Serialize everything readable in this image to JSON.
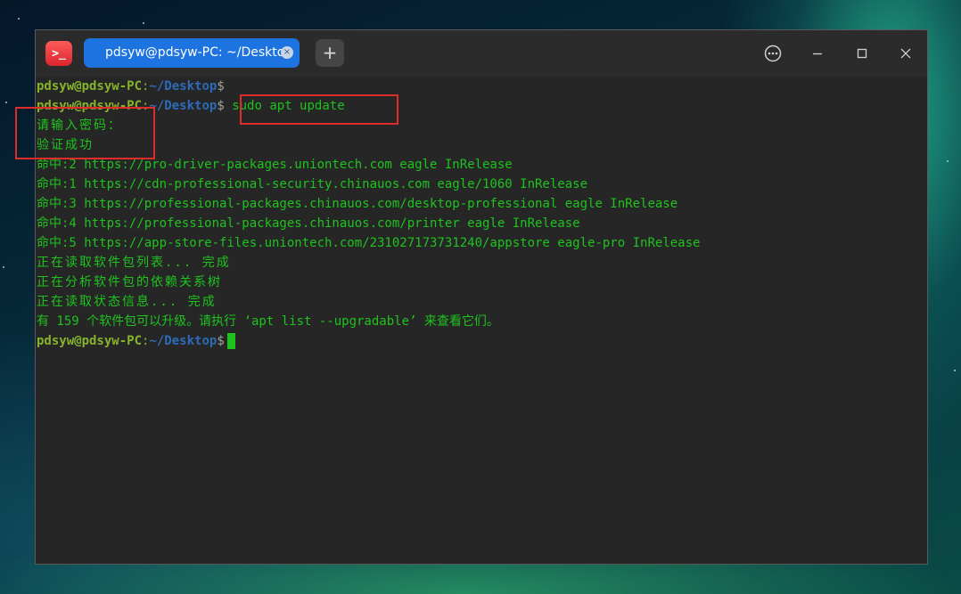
{
  "window": {
    "tab_title": "pdsyw@pdsyw-PC: ~/Desktop",
    "tab_close_glyph": "×",
    "add_tab_glyph": "+",
    "app_icon_glyph": ">_",
    "accent_color": "#1d74e0"
  },
  "terminal": {
    "prompt_user": "pdsyw@pdsyw-PC",
    "prompt_colon": ":",
    "prompt_path": "~/Desktop",
    "prompt_dollar": "$",
    "command": "sudo apt update",
    "password_prompt": "请输入密码：",
    "auth_success": "验证成功",
    "hits": [
      "命中:2 https://pro-driver-packages.uniontech.com eagle InRelease",
      "命中:1 https://cdn-professional-security.chinauos.com eagle/1060 InRelease",
      "命中:3 https://professional-packages.chinauos.com/desktop-professional eagle InRelease",
      "命中:4 https://professional-packages.chinauos.com/printer eagle InRelease",
      "命中:5 https://app-store-files.uniontech.com/231027173731240/appstore eagle-pro InRelease"
    ],
    "reading_lists": "正在读取软件包列表... 完成",
    "analyzing_deps": "正在分析软件包的依赖关系树",
    "reading_state": "正在读取状态信息... 完成",
    "upgradable_msg": "有 159 个软件包可以升级。请执行 ‘apt list --upgradable’ 来查看它们。",
    "text_color": "#1ec31e",
    "user_color": "#85b42a",
    "path_color": "#2d6bb8"
  }
}
